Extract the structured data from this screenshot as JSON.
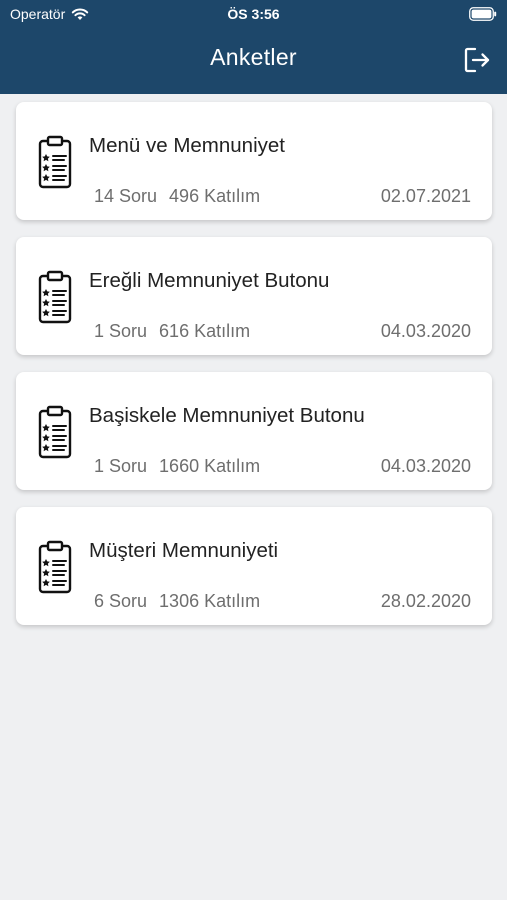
{
  "status_bar": {
    "carrier": "Operatör",
    "time": "ÖS 3:56"
  },
  "header": {
    "title": "Anketler",
    "logout_icon": "logout-icon"
  },
  "surveys": [
    {
      "title": "Menü ve Memnuniyet",
      "questions": "14 Soru",
      "participation": "496 Katılım",
      "date": "02.07.2021"
    },
    {
      "title": "Ereğli Memnuniyet Butonu",
      "questions": "1 Soru",
      "participation": "616 Katılım",
      "date": "04.03.2020"
    },
    {
      "title": "Başiskele Memnuniyet Butonu",
      "questions": "1 Soru",
      "participation": "1660 Katılım",
      "date": "04.03.2020"
    },
    {
      "title": "Müşteri Memnuniyeti",
      "questions": "6 Soru",
      "participation": "1306 Katılım",
      "date": "28.02.2020"
    }
  ],
  "colors": {
    "header_bg": "#1d476a",
    "page_bg": "#eff0f2",
    "card_bg": "#ffffff"
  }
}
